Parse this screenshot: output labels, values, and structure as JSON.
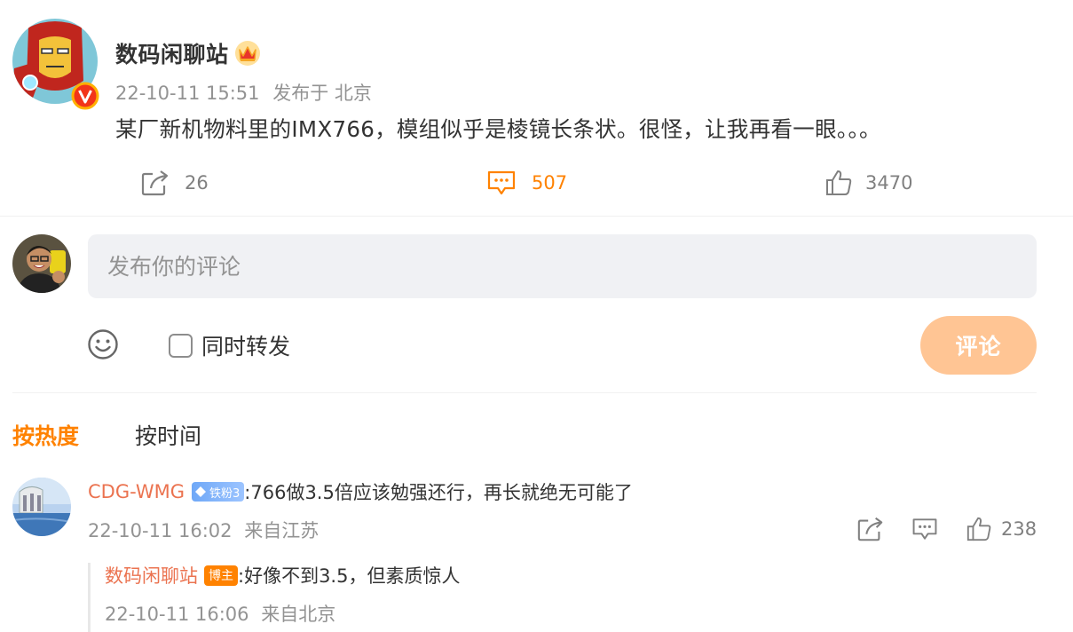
{
  "post": {
    "author": "数码闲聊站",
    "date": "22-10-11 15:51",
    "location": "发布于 北京",
    "text": "某厂新机物料里的IMX766，模组似乎是棱镜长条状。很怪，让我再看一眼。。。",
    "reposts": "26",
    "comments": "507",
    "likes": "3470"
  },
  "composer": {
    "placeholder": "发布你的评论",
    "repost_label": "同时转发",
    "submit_label": "评论"
  },
  "tabs": {
    "hot": "按热度",
    "time": "按时间"
  },
  "comment": {
    "user": "CDG-WMG",
    "fan_badge": "铁粉3",
    "text": ":766做3.5倍应该勉强还行，再长就绝无可能了",
    "date": "22-10-11 16:02",
    "location": "来自江苏",
    "likes": "238"
  },
  "reply": {
    "user": "数码闲聊站",
    "badge": "博主",
    "text": ":好像不到3.5，但素质惊人",
    "date": "22-10-11 16:06",
    "location": "来自北京"
  },
  "colors": {
    "accent": "#ff8200",
    "username": "#eb7350",
    "muted": "#939393",
    "submit_bg": "#ffc594"
  }
}
